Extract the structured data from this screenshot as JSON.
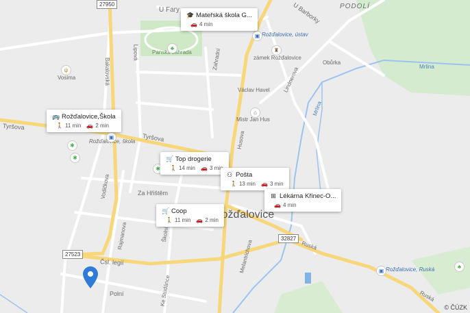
{
  "places": {
    "town": "Rožďalovice",
    "podoli": "PODOLÍ",
    "u_fary": "U Fary",
    "u_barborky": "U Barborky",
    "panska_zahrada": "Panská zahrada",
    "zamek": "zámek Rožďalovice",
    "vosima": "Vosima",
    "obuvka": "Obůrka",
    "mistr_jan_hus": "Mistr Jan Hus",
    "vaclav_havel": "Václav Havel",
    "rozdalovice_skola_label": "Rožďalovice, škola",
    "rozdalovice_ustav": "Rožďalovice, ústav",
    "rozdalovice_ruska": "Rožďalovice, Ruská"
  },
  "streets": {
    "tyrsova_west": "Tyršova",
    "tyrsova_mid": "Tyršova",
    "bakalovska": "Bakalovská",
    "lipova": "Lipová",
    "zahradni": "Zahradní",
    "husova": "Husova",
    "lindnerova": "Lindnerova",
    "vodickova": "Vodičkova",
    "za_hristem": "Za Hřištěm",
    "rajmanova": "Rajmanova",
    "cs_legii": "Čsl. legií",
    "polni": "Polní",
    "ke_studance": "Ke Studánce",
    "skolni": "Školní",
    "melantrichova": "Melantrichova",
    "ruska": "Ruská",
    "ruska2": "Ruská"
  },
  "road_numbers": {
    "r27950": "27950",
    "r27523": "27523",
    "r32827": "32827"
  },
  "rivers": {
    "mrlina_top": "Mrlina",
    "mrlina_mid": "Mrlina"
  },
  "poi_cards": {
    "materska_skola": {
      "title": "Mateřská škola G...",
      "drive": "4 min"
    },
    "skola": {
      "title": "Rožďalovice,Škola",
      "walk": "11 min",
      "drive": "2 min"
    },
    "drogerie": {
      "title": "Top drogerie",
      "walk": "14 min",
      "drive": "3 min"
    },
    "posta": {
      "title": "Pošta",
      "walk": "13 min",
      "drive": "3 min"
    },
    "lekarna": {
      "title": "Lékárna Křinec-O...",
      "drive": "4 min"
    },
    "coop": {
      "title": "Coop",
      "walk": "11 min",
      "drive": "2 min"
    }
  },
  "copyright": "© ČÚZK",
  "colors": {
    "road_major": "#f7d77a",
    "road_minor": "#ffffff",
    "water": "#9cc3ef",
    "park": "#cfe9c7",
    "marker": "#2f7bd9"
  }
}
